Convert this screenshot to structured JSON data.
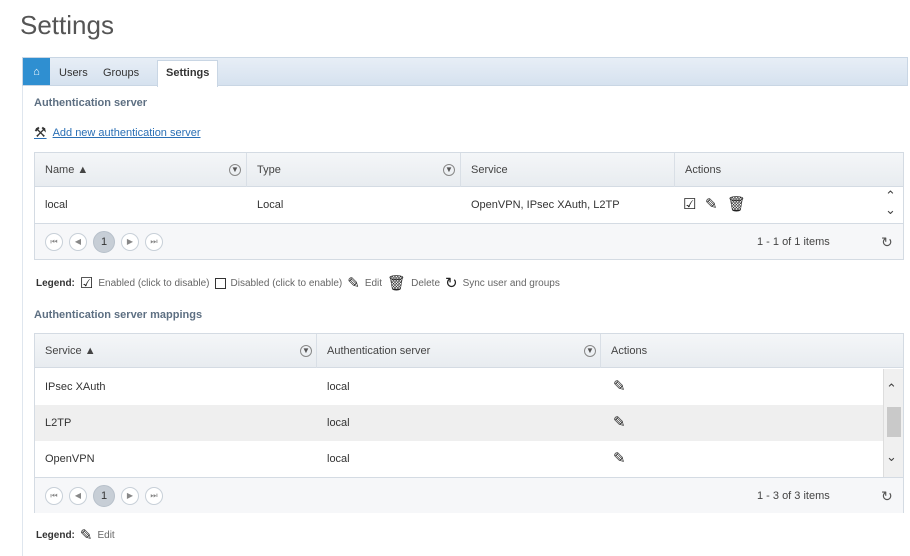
{
  "page": {
    "title": "Settings"
  },
  "tabs": {
    "home_icon": "home-icon",
    "users": "Users",
    "groups": "Groups",
    "settings": "Settings"
  },
  "auth_server": {
    "section_title": "Authentication server",
    "add_link": "Add new authentication server",
    "columns": {
      "name": "Name ▲",
      "type": "Type",
      "service": "Service",
      "actions": "Actions"
    },
    "rows": [
      {
        "name": "local",
        "type": "Local",
        "service": "OpenVPN, IPsec XAuth, L2TP"
      }
    ],
    "pager": {
      "page": "1",
      "info": "1 - 1 of 1 items"
    }
  },
  "legend1": {
    "label": "Legend:",
    "enabled": "Enabled (click to disable)",
    "disabled": "Disabled (click to enable)",
    "edit": "Edit",
    "delete": "Delete",
    "sync": "Sync user and groups"
  },
  "mappings": {
    "section_title": "Authentication server mappings",
    "columns": {
      "service": "Service ▲",
      "auth_server": "Authentication server",
      "actions": "Actions"
    },
    "rows": [
      {
        "service": "IPsec XAuth",
        "server": "local"
      },
      {
        "service": "L2TP",
        "server": "local"
      },
      {
        "service": "OpenVPN",
        "server": "local"
      }
    ],
    "pager": {
      "page": "1",
      "info": "1 - 3 of 3 items"
    }
  },
  "legend2": {
    "label": "Legend:",
    "edit": "Edit"
  },
  "colors": {
    "accent": "#2f8fd1",
    "link": "#2a6fb5",
    "alt_row": "#efefef"
  }
}
